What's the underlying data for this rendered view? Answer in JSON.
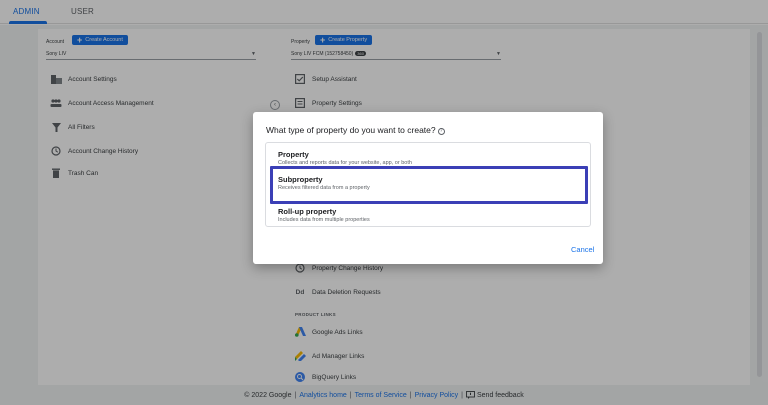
{
  "tabs": {
    "admin": "ADMIN",
    "user": "USER"
  },
  "account": {
    "label": "Account",
    "create_button": "Create Account",
    "selected": "Sony LIV",
    "items": [
      {
        "label": "Account Settings",
        "icon": "building-icon"
      },
      {
        "label": "Account Access Management",
        "icon": "people-icon"
      },
      {
        "label": "All Filters",
        "icon": "filter-icon"
      },
      {
        "label": "Account Change History",
        "icon": "history-icon"
      },
      {
        "label": "Trash Can",
        "icon": "trash-icon"
      }
    ]
  },
  "property": {
    "label": "Property",
    "create_button": "Create Property",
    "selected": "Sony LIV FCM (152758450)",
    "badge": "360",
    "items_top": [
      {
        "label": "Setup Assistant",
        "icon": "checkbox-icon"
      },
      {
        "label": "Property Settings",
        "icon": "settings-page-icon"
      }
    ],
    "items_bottom": [
      {
        "label": "Property Change History",
        "icon": "history-icon"
      },
      {
        "label": "Data Deletion Requests",
        "icon": "dd-icon",
        "glyph": "Dd"
      }
    ],
    "product_links_label": "PRODUCT LINKS",
    "product_links": [
      {
        "label": "Google Ads Links",
        "icon": "google-ads-icon"
      },
      {
        "label": "Ad Manager Links",
        "icon": "ad-manager-icon"
      },
      {
        "label": "BigQuery Links",
        "icon": "bigquery-icon"
      }
    ]
  },
  "dialog": {
    "title": "What type of property do you want to create?",
    "options": [
      {
        "name": "Property",
        "desc": "Collects and reports data for your website, app, or both"
      },
      {
        "name": "Subproperty",
        "desc": "Receives filtered data from a property"
      },
      {
        "name": "Roll-up property",
        "desc": "Includes data from multiple properties"
      }
    ],
    "cancel": "Cancel",
    "highlight_color": "#3b3fb6"
  },
  "footer": {
    "copyright": "© 2022 Google",
    "sep": "|",
    "analytics_home": "Analytics home",
    "terms": "Terms of Service",
    "privacy": "Privacy Policy",
    "feedback": "Send feedback"
  },
  "colors": {
    "accent": "#1a73e8",
    "overlay": "rgba(0,0,0,0.32)"
  }
}
